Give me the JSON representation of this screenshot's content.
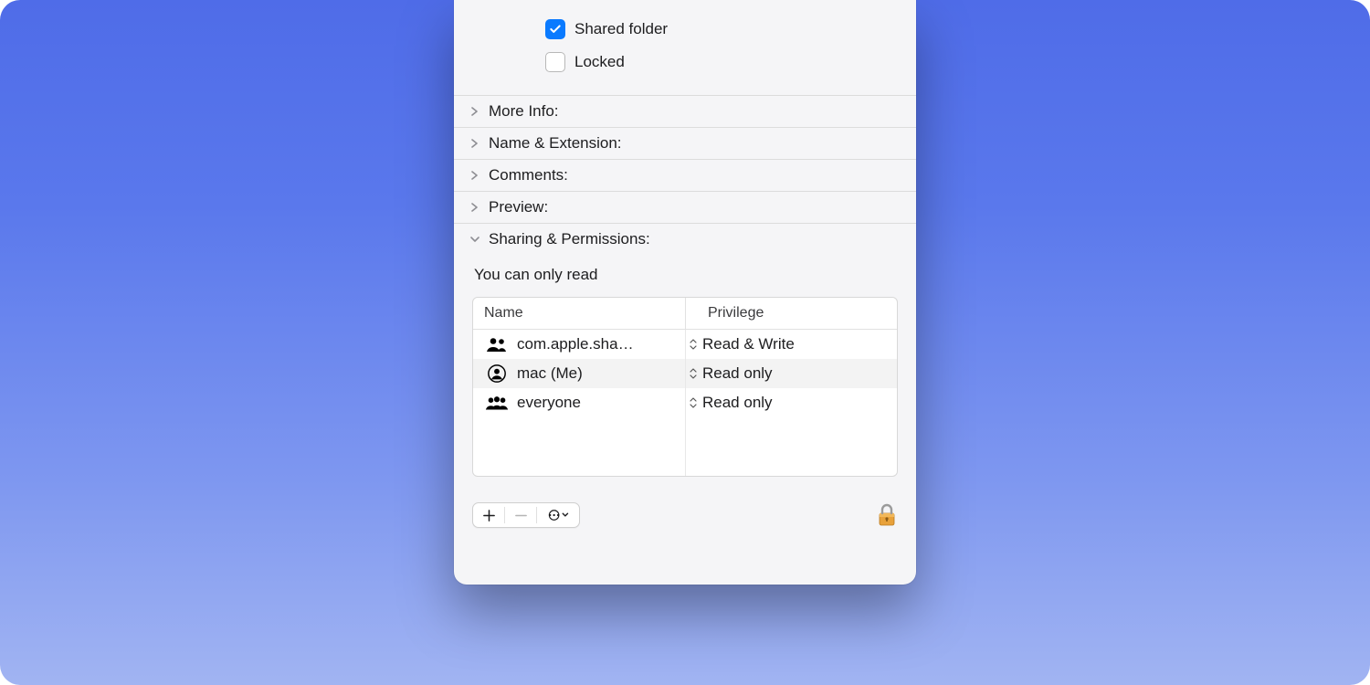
{
  "general": {
    "shared_folder_label": "Shared folder",
    "shared_folder_checked": true,
    "locked_label": "Locked",
    "locked_checked": false
  },
  "sections": {
    "more_info": "More Info:",
    "name_ext": "Name & Extension:",
    "comments": "Comments:",
    "preview": "Preview:",
    "sharing": "Sharing & Permissions:"
  },
  "permissions": {
    "hint": "You can only read",
    "columns": {
      "name": "Name",
      "privilege": "Privilege"
    },
    "rows": [
      {
        "icon": "group",
        "name": "com.apple.sha…",
        "privilege": "Read & Write"
      },
      {
        "icon": "user",
        "name": "mac (Me)",
        "privilege": "Read only"
      },
      {
        "icon": "group3",
        "name": "everyone",
        "privilege": "Read only"
      }
    ]
  },
  "footer": {
    "add_label": "+",
    "remove_label": "−",
    "action_label": "⋯"
  }
}
